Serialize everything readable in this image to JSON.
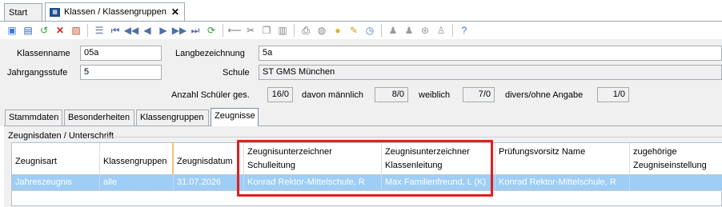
{
  "tabs": {
    "start": "Start",
    "klassen": "Klassen / Klassengruppen",
    "close": "✕"
  },
  "toolbar": {
    "icons": [
      "new-icon",
      "save-icon",
      "undo-icon",
      "delete-icon",
      "copy-record-icon",
      "list-icon",
      "first-icon",
      "prev-page-icon",
      "prev-icon",
      "next-icon",
      "next-page-icon",
      "last-icon",
      "refresh-icon",
      "back-icon",
      "cut-icon",
      "copy-icon",
      "paste-icon",
      "print-icon",
      "preview-icon",
      "bulb-icon",
      "clean-icon",
      "clock-icon",
      "group-icon",
      "group2-icon",
      "filter-icon",
      "users-icon",
      "help-icon"
    ]
  },
  "form": {
    "klassenname_label": "Klassenname",
    "klassenname_value": "05a",
    "langbezeichnung_label": "Langbezeichnung",
    "langbezeichnung_value": "5a",
    "jahrgangsstufe_label": "Jahrgangsstufe",
    "jahrgangsstufe_value": "5",
    "schule_label": "Schule",
    "schule_value": "ST GMS München",
    "anzahl_label": "Anzahl Schüler ges.",
    "anzahl_value": "16/0",
    "maennlich_label": "davon männlich",
    "maennlich_value": "8/0",
    "weiblich_label": "weiblich",
    "weiblich_value": "7/0",
    "divers_label": "divers/ohne Angabe",
    "divers_value": "1/0"
  },
  "content_tabs": [
    "Stammdaten",
    "Besonderheiten",
    "Klassengruppen",
    "Zeugnisse"
  ],
  "section_title": "Zeugnisdaten / Unterschrift",
  "grid": {
    "headers": [
      "Zeugnisart",
      "Klassengruppen",
      "Zeugnisdatum",
      "Zeugnisunterzeichner Schulleitung",
      "Zeugnisunterzeichner Klassenleitung",
      "Prüfungsvorsitz Name",
      "zugehörige Zeugniseinstellung"
    ],
    "row": [
      "Jahreszeugnis",
      "alle",
      "31.07.2026",
      "Konrad Rektor-Mittelschule, R",
      "Max Familienfreund, L (K)",
      "Konrad Rektor-Mittelschule, R",
      ""
    ]
  },
  "colors": {
    "selection": "#9ecdf5",
    "highlight": "#e0201e",
    "sort_marker": "#f3c27a"
  }
}
